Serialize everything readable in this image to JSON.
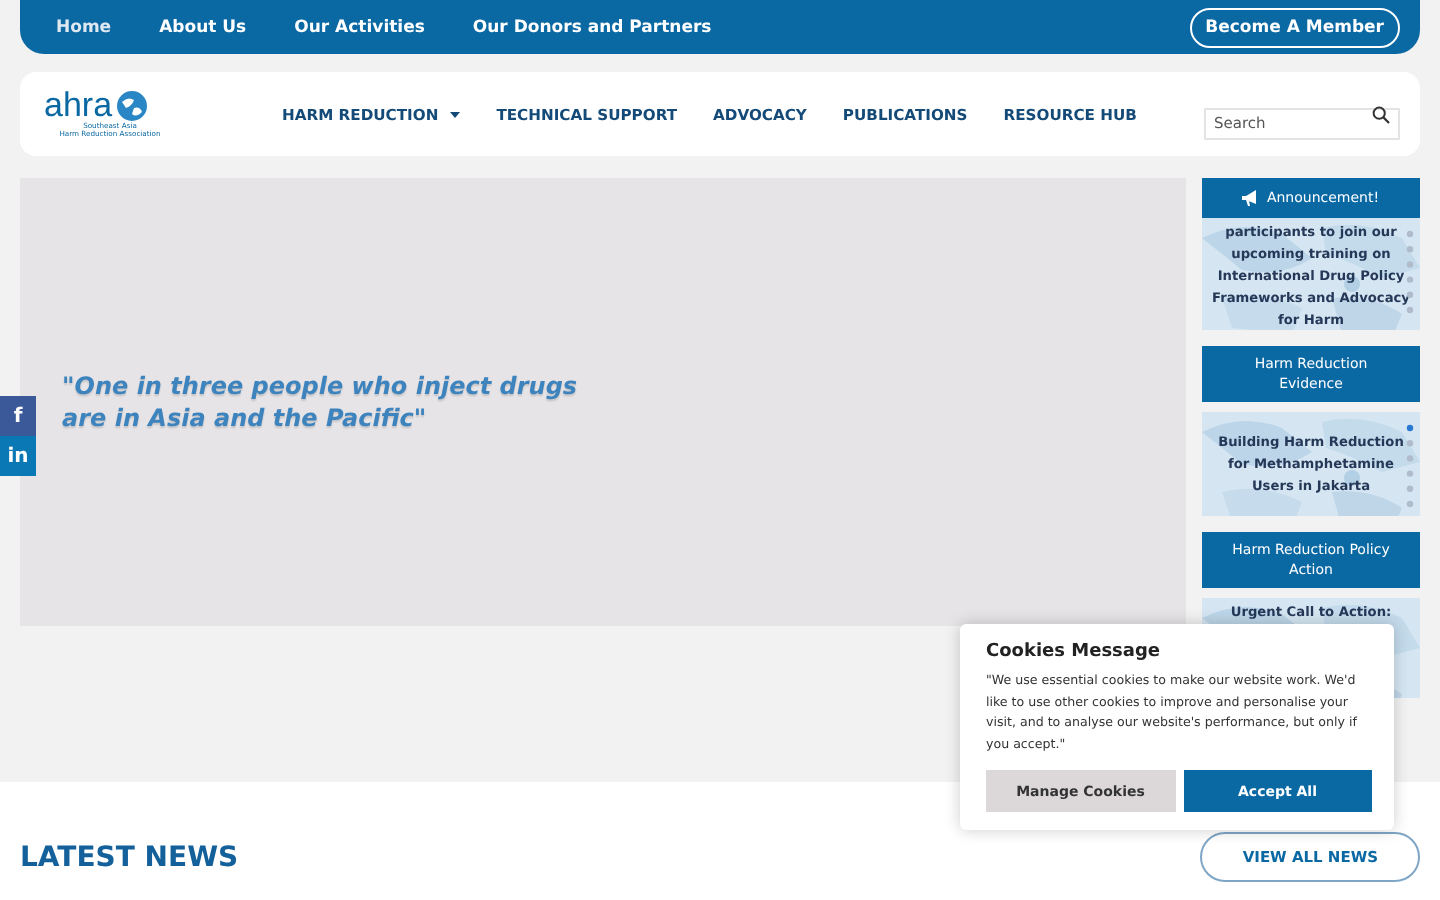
{
  "top_bar": {
    "links": [
      {
        "label": "Home",
        "selected": true
      },
      {
        "label": "About Us",
        "selected": false
      },
      {
        "label": "Our Activities",
        "selected": false
      },
      {
        "label": "Our Donors and Partners",
        "selected": false
      }
    ],
    "member_button": "Become A Member"
  },
  "header": {
    "logo": {
      "name": "ahra",
      "tagline": "Southeast Asia\nHarm Reduction Association"
    },
    "menu": [
      {
        "label": "HARM REDUCTION",
        "dropdown": true
      },
      {
        "label": "TECHNICAL SUPPORT",
        "dropdown": false
      },
      {
        "label": "ADVOCACY",
        "dropdown": false
      },
      {
        "label": "PUBLICATIONS",
        "dropdown": false
      },
      {
        "label": "RESOURCE HUB",
        "dropdown": false
      }
    ],
    "search": {
      "placeholder": "Search"
    }
  },
  "hero": {
    "quote": "\"One in three people who inject drugs are in Asia and the Pacific\""
  },
  "social": [
    {
      "kind": "facebook",
      "label": "f"
    },
    {
      "kind": "linkedin",
      "label": "in"
    }
  ],
  "sidebar": [
    {
      "title": "Announcement!",
      "announce_icon": true,
      "text": "participants to join our upcoming training on International Drug Policy Frameworks and Advocacy for Harm"
    },
    {
      "title": "Harm Reduction Evidence",
      "announce_icon": false,
      "text": "Building Harm Reduction for Methamphetamine Users in Jakarta"
    },
    {
      "title": "Harm Reduction Policy Action",
      "announce_icon": false,
      "text": "Urgent Call to Action:"
    }
  ],
  "latest_news": {
    "title": "LATEST NEWS",
    "button": "VIEW ALL NEWS"
  },
  "cookies": {
    "title": "Cookies Message",
    "text": "\"We use essential cookies to make our website work. We'd like to use other cookies to improve and personalise your visit, and to analyse our website's performance, but only if you accept.\"",
    "buttons": [
      {
        "label": "Manage Cookies",
        "kind": "secondary"
      },
      {
        "label": "Accept All",
        "kind": "primary"
      }
    ]
  }
}
